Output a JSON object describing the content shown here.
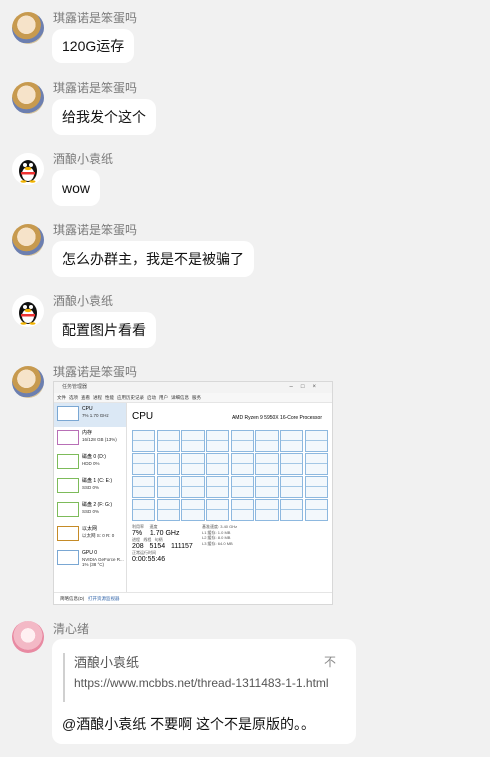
{
  "messages": [
    {
      "sender": "琪露诺是笨蛋吗",
      "avatar": "anime-avatar",
      "text": "120G运存"
    },
    {
      "sender": "琪露诺是笨蛋吗",
      "avatar": "anime-avatar",
      "text": "给我发个这个"
    },
    {
      "sender": "酒酿小袁纸",
      "avatar": "qq-penguin-avatar",
      "text": "wow"
    },
    {
      "sender": "琪露诺是笨蛋吗",
      "avatar": "anime-avatar",
      "text": "怎么办群主，我是不是被骗了"
    },
    {
      "sender": "酒酿小袁纸",
      "avatar": "qq-penguin-avatar",
      "text": "配置图片看看"
    },
    {
      "sender": "琪露诺是笨蛋吗",
      "avatar": "anime-avatar",
      "image": "task-manager-screenshot"
    },
    {
      "sender": "清心绪",
      "avatar": "pink-hair-avatar",
      "quote": {
        "name": "酒酿小袁纸",
        "url": "https://www.mcbbs.net/thread-1311483-1-1.html",
        "icon": "不"
      },
      "text": "@酒酿小袁纸 不要啊 这个不是原版的。。"
    }
  ],
  "taskmanager": {
    "cpu_heading": "CPU",
    "cpu_model": "AMD Ryzen 9 5950X 16-Core Processor",
    "sidebar": [
      {
        "name": "CPU",
        "sub": "7% 1.70 GHz"
      },
      {
        "name": "内存",
        "sub": "16/128 GB (13%)"
      },
      {
        "name": "磁盘 0 (D:)",
        "sub": "HDD\n0%"
      },
      {
        "name": "磁盘 1 (C: E:)",
        "sub": "SSD\n0%"
      },
      {
        "name": "磁盘 2 (F: G:)",
        "sub": "SSD\n0%"
      },
      {
        "name": "以太网",
        "sub": "以太网\nS: 0 R: 0"
      },
      {
        "name": "GPU 0",
        "sub": "NVIDIA GeForce R...\n1% (38 °C)"
      }
    ],
    "utilization": "7%",
    "speed": "1.70 GHz",
    "processes": "208",
    "threads": "5154",
    "handles": "111157",
    "uptime": "0:00:55:46",
    "base_speed": "3.40 GHz",
    "l1": "1.0 MB",
    "l2": "8.0 MB",
    "l3": "64.0 MB",
    "bottom_link": "打开资源监视器",
    "bottom_left": "简略信息(D)"
  }
}
